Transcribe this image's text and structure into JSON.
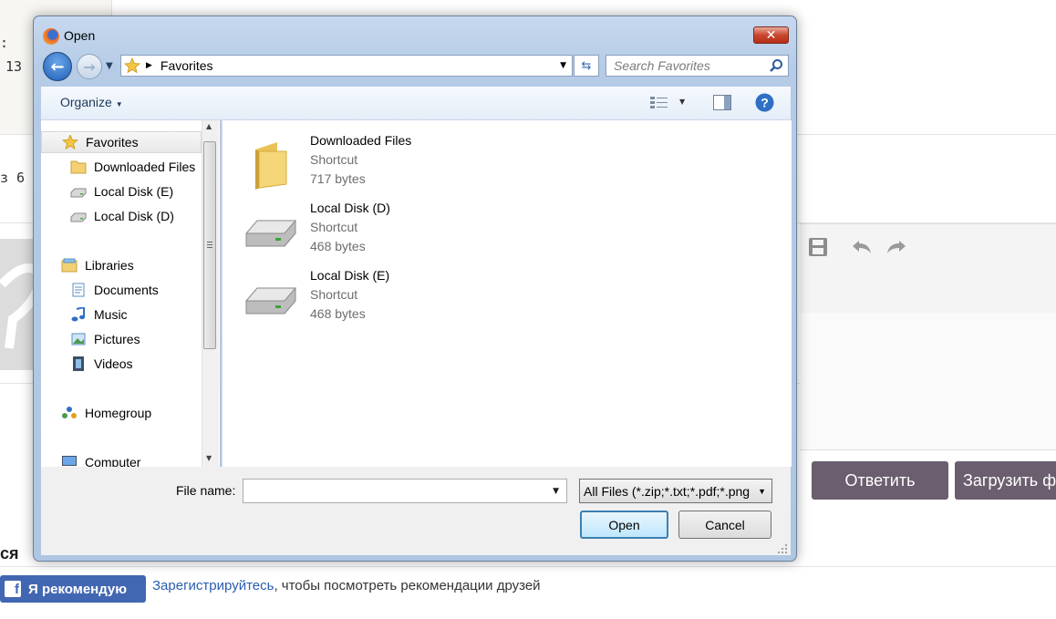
{
  "background": {
    "fragments": [
      ":",
      "13",
      "з 6"
    ],
    "fb_button": {
      "label": "Я рекомендую",
      "logo": "f"
    },
    "recommend": {
      "link": "Зарегистрируйтесь",
      "text": ", чтобы посмотреть рекомендации друзей"
    },
    "reply_button": "Ответить",
    "upload_button": "Загрузить ф",
    "icons": [
      "save-icon",
      "undo-icon",
      "redo-icon"
    ]
  },
  "dialog": {
    "title": "Open",
    "close_glyph": "✕",
    "address": {
      "location": "Favorites"
    },
    "search": {
      "placeholder": "Search Favorites"
    },
    "toolbar": {
      "organize_label": "Organize"
    },
    "nav": {
      "favorites": "Favorites",
      "favorites_items": [
        "Downloaded Files",
        "Local Disk (E)",
        "Local Disk (D)"
      ],
      "libraries": "Libraries",
      "libraries_items": [
        "Documents",
        "Music",
        "Pictures",
        "Videos"
      ],
      "homegroup": "Homegroup",
      "computer": "Computer"
    },
    "files": [
      {
        "name": "Downloaded Files",
        "type": "Shortcut",
        "size": "717 bytes",
        "icon": "folder-icon"
      },
      {
        "name": "Local Disk (D)",
        "type": "Shortcut",
        "size": "468 bytes",
        "icon": "drive-icon"
      },
      {
        "name": "Local Disk (E)",
        "type": "Shortcut",
        "size": "468 bytes",
        "icon": "drive-icon"
      }
    ],
    "file_name": {
      "label": "File name:",
      "value": ""
    },
    "file_type": {
      "selected": "All Files (*.zip;*.txt;*.pdf;*.png"
    },
    "buttons": {
      "open": "Open",
      "cancel": "Cancel"
    },
    "colors": {
      "accent": "#3c7fb1",
      "close": "#c9472f"
    }
  }
}
